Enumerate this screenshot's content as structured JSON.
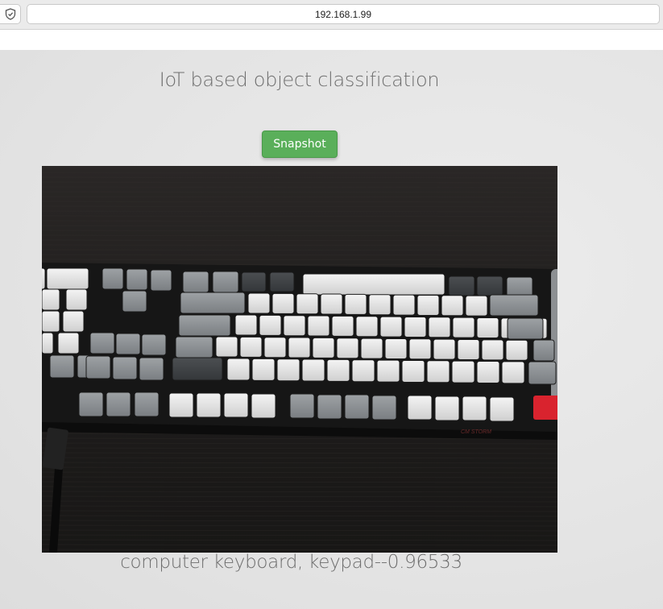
{
  "browser": {
    "url": "192.168.1.99",
    "shield_icon": "shield-icon"
  },
  "page": {
    "title": "IoT based object classification",
    "snapshot_label": "Snapshot",
    "result_text": "computer keyboard, keypad--0.96533"
  },
  "colors": {
    "button_green": "#5aaf5a",
    "text_gray": "#6e6e6e",
    "page_background": "#e6e6e6",
    "keyboard_accent_key": "#d9232e"
  }
}
